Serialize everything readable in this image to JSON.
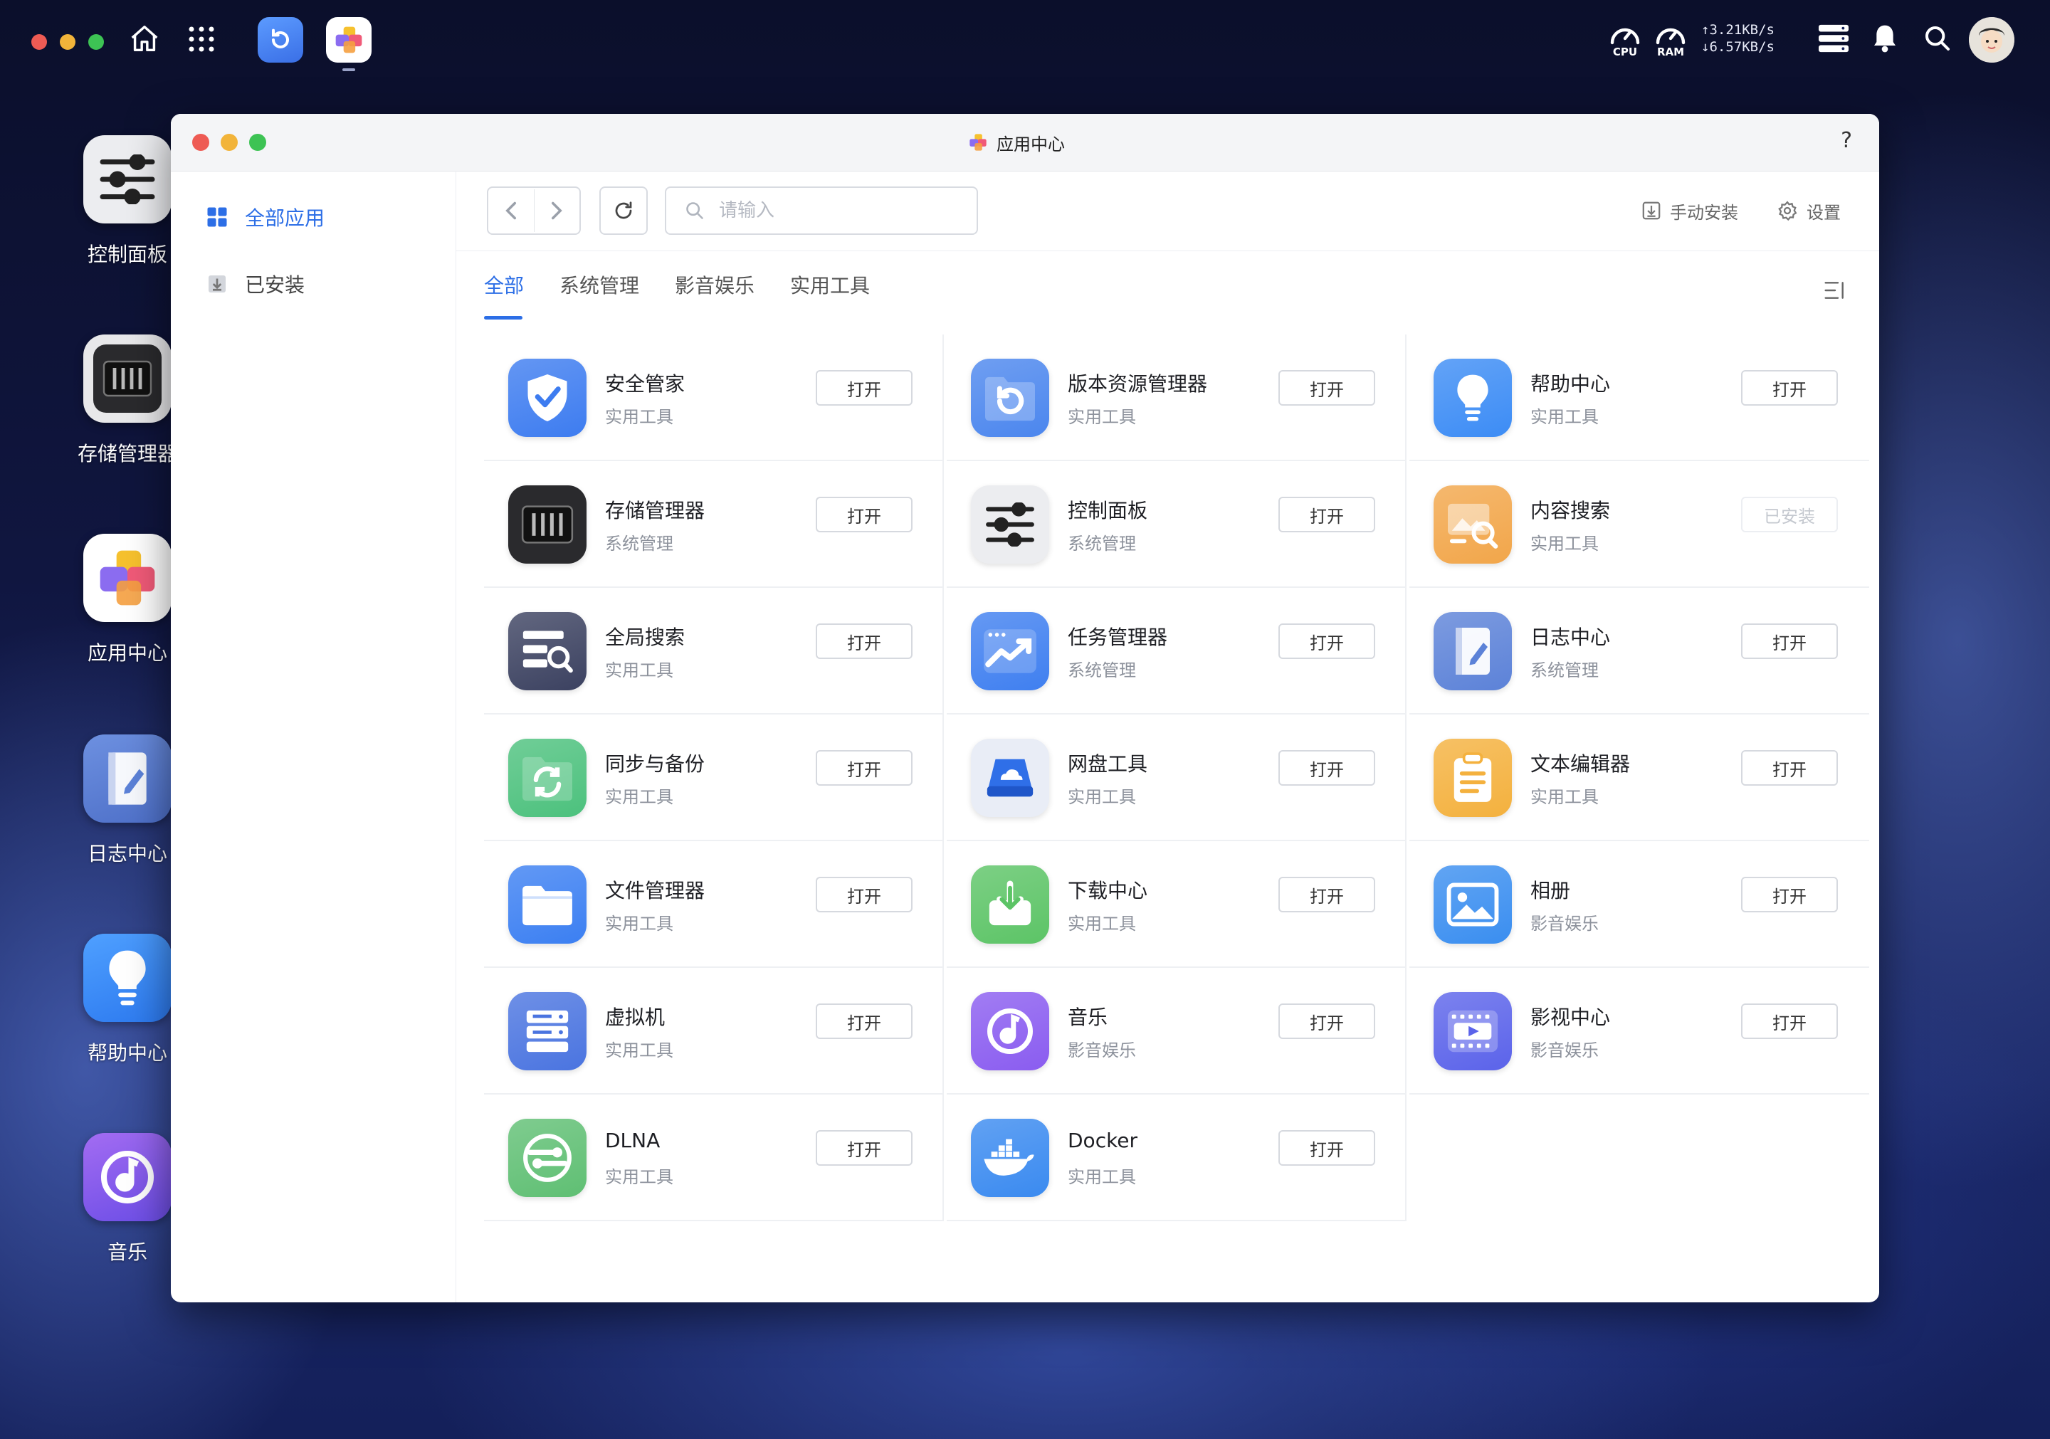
{
  "topbar": {
    "upload_speed": "↑3.21KB/s",
    "download_speed": "↓6.57KB/s",
    "cpu_label": "CPU",
    "ram_label": "RAM"
  },
  "desktop": {
    "icons": [
      {
        "label": "控制面板",
        "icon": "sliders-icon"
      },
      {
        "label": "存储管理器",
        "icon": "storage-icon"
      },
      {
        "label": "应用中心",
        "icon": "app-center-icon"
      },
      {
        "label": "日志中心",
        "icon": "log-icon"
      },
      {
        "label": "帮助中心",
        "icon": "lightbulb-icon"
      },
      {
        "label": "音乐",
        "icon": "music-icon"
      }
    ]
  },
  "window": {
    "title": "应用中心",
    "help": "?"
  },
  "sidebar": {
    "items": [
      {
        "label": "全部应用",
        "active": true
      },
      {
        "label": "已安装",
        "active": false
      }
    ]
  },
  "toolbar": {
    "search_placeholder": "请输入",
    "manual_install": "手动安装",
    "settings": "设置"
  },
  "tabs": [
    {
      "label": "全部",
      "active": true
    },
    {
      "label": "系统管理",
      "active": false
    },
    {
      "label": "影音娱乐",
      "active": false
    },
    {
      "label": "实用工具",
      "active": false
    }
  ],
  "apps": [
    {
      "name": "安全管家",
      "category": "实用工具",
      "action": "打开",
      "icon": "shield-icon",
      "color": "#3d7cf0"
    },
    {
      "name": "版本资源管理器",
      "category": "实用工具",
      "action": "打开",
      "icon": "version-folder-icon",
      "color": "#4b86ee"
    },
    {
      "name": "帮助中心",
      "category": "实用工具",
      "action": "打开",
      "icon": "lightbulb-icon",
      "color": "#3c8cf5"
    },
    {
      "name": "存储管理器",
      "category": "系统管理",
      "action": "打开",
      "icon": "storage-icon",
      "color": "#2b2b2e"
    },
    {
      "name": "控制面板",
      "category": "系统管理",
      "action": "打开",
      "icon": "sliders-icon",
      "color": "#ecedf0"
    },
    {
      "name": "内容搜索",
      "category": "实用工具",
      "action": "已安装",
      "icon": "image-search-icon",
      "color": "#f2a64a"
    },
    {
      "name": "全局搜索",
      "category": "实用工具",
      "action": "打开",
      "icon": "global-search-icon",
      "color": "#3b4160"
    },
    {
      "name": "任务管理器",
      "category": "系统管理",
      "action": "打开",
      "icon": "task-chart-icon",
      "color": "#3f7ff0"
    },
    {
      "name": "日志中心",
      "category": "系统管理",
      "action": "打开",
      "icon": "log-icon",
      "color": "#5c82d8"
    },
    {
      "name": "同步与备份",
      "category": "实用工具",
      "action": "打开",
      "icon": "sync-icon",
      "color": "#4cc17d"
    },
    {
      "name": "网盘工具",
      "category": "实用工具",
      "action": "打开",
      "icon": "cloud-drive-icon",
      "color": "#e9edf6"
    },
    {
      "name": "文本编辑器",
      "category": "实用工具",
      "action": "打开",
      "icon": "notepad-icon",
      "color": "#f4b13e"
    },
    {
      "name": "文件管理器",
      "category": "实用工具",
      "action": "打开",
      "icon": "folder-icon",
      "color": "#3b7ff2"
    },
    {
      "name": "下载中心",
      "category": "实用工具",
      "action": "打开",
      "icon": "download-icon",
      "color": "#5cc466"
    },
    {
      "name": "相册",
      "category": "影音娱乐",
      "action": "打开",
      "icon": "photo-icon",
      "color": "#3a8ef0"
    },
    {
      "name": "虚拟机",
      "category": "实用工具",
      "action": "打开",
      "icon": "vm-icon",
      "color": "#4a74e0"
    },
    {
      "name": "音乐",
      "category": "影音娱乐",
      "action": "打开",
      "icon": "music-icon",
      "color": "#8a5cf0"
    },
    {
      "name": "影视中心",
      "category": "影音娱乐",
      "action": "打开",
      "icon": "video-icon",
      "color": "#5b63ea"
    },
    {
      "name": "DLNA",
      "category": "实用工具",
      "action": "打开",
      "icon": "dlna-icon",
      "color": "#5fbf73"
    },
    {
      "name": "Docker",
      "category": "实用工具",
      "action": "打开",
      "icon": "docker-icon",
      "color": "#3a8af0"
    }
  ]
}
